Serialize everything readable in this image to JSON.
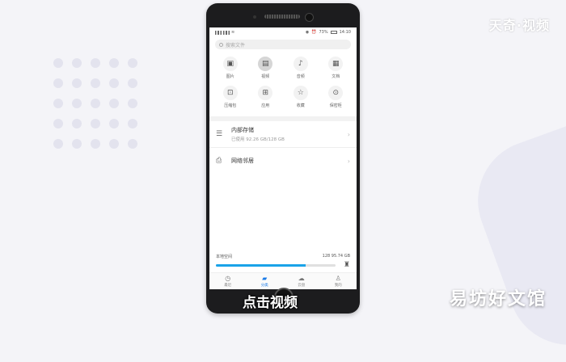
{
  "overlay": {
    "watermark": "天奇·视频",
    "subtitle": "点击视频",
    "brand": "易坊好文馆"
  },
  "status_bar": {
    "battery": "73%",
    "time": "14:10"
  },
  "search": {
    "placeholder": "搜索文件"
  },
  "categories": [
    {
      "label": "图片",
      "icon": "image-icon"
    },
    {
      "label": "视频",
      "icon": "video-icon",
      "active": true
    },
    {
      "label": "音频",
      "icon": "audio-icon"
    },
    {
      "label": "文档",
      "icon": "document-icon"
    },
    {
      "label": "压缩包",
      "icon": "archive-icon"
    },
    {
      "label": "应用",
      "icon": "app-icon"
    },
    {
      "label": "收藏",
      "icon": "favorite-icon"
    },
    {
      "label": "保密柜",
      "icon": "safe-icon"
    }
  ],
  "locations": [
    {
      "title": "内部存储",
      "subtitle": "已使用 92.26 GB/128 GB",
      "icon": "storage-icon"
    },
    {
      "title": "网络邻居",
      "icon": "network-icon"
    }
  ],
  "storage": {
    "label": "本地空间",
    "usage": "128 95.74 GB",
    "fill_fraction": 0.75,
    "accent": "#1aa3e8"
  },
  "tabs": [
    {
      "label": "最近",
      "icon": "clock-icon"
    },
    {
      "label": "分类",
      "icon": "folder-icon",
      "active": true
    },
    {
      "label": "云盘",
      "icon": "cloud-icon"
    },
    {
      "label": "我的",
      "icon": "user-icon"
    }
  ]
}
